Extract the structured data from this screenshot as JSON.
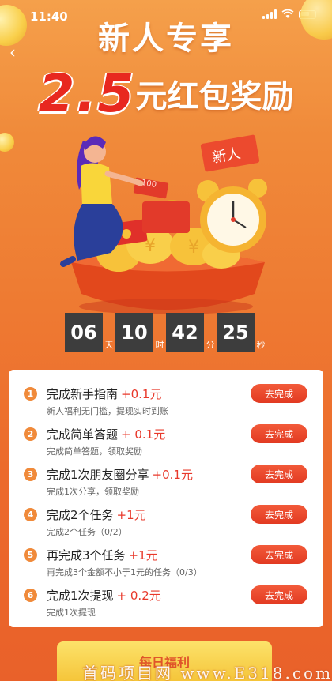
{
  "status_bar": {
    "time": "11:40"
  },
  "header": {
    "title": "新人专享",
    "amount": "2.5",
    "amount_suffix": "元红包奖励",
    "tag": "新人",
    "envelope_label": "100"
  },
  "countdown": {
    "days": "06",
    "days_unit": "天",
    "hours": "10",
    "hours_unit": "时",
    "minutes": "42",
    "minutes_unit": "分",
    "seconds": "25",
    "seconds_unit": "秒"
  },
  "tasks": [
    {
      "num": "1",
      "name": "完成新手指南",
      "reward": "+0.1元",
      "desc": "新人福利无门槛，提现实时到账",
      "button": "去完成"
    },
    {
      "num": "2",
      "name": "完成简单答题",
      "reward": "+ 0.1元",
      "desc": "完成简单答题，领取奖励",
      "button": "去完成"
    },
    {
      "num": "3",
      "name": "完成1次朋友圈分享",
      "reward": "+0.1元",
      "desc": "完成1次分享，领取奖励",
      "button": "去完成"
    },
    {
      "num": "4",
      "name": "完成2个任务",
      "reward": "+1元",
      "desc": "完成2个任务（0/2）",
      "button": "去完成"
    },
    {
      "num": "5",
      "name": "再完成3个任务",
      "reward": "+1元",
      "desc": "再完成3个金额不小于1元的任务（0/3）",
      "button": "去完成"
    },
    {
      "num": "6",
      "name": "完成1次提现",
      "reward": "+ 0.2元",
      "desc": "完成1次提现",
      "button": "去完成"
    }
  ],
  "bottom_button": "每日福利",
  "watermark": "首码项目网 www.E318.com",
  "colors": {
    "accent_red": "#e8382a",
    "orange": "#f08a3a",
    "countdown_bg": "#3d3d3d"
  }
}
